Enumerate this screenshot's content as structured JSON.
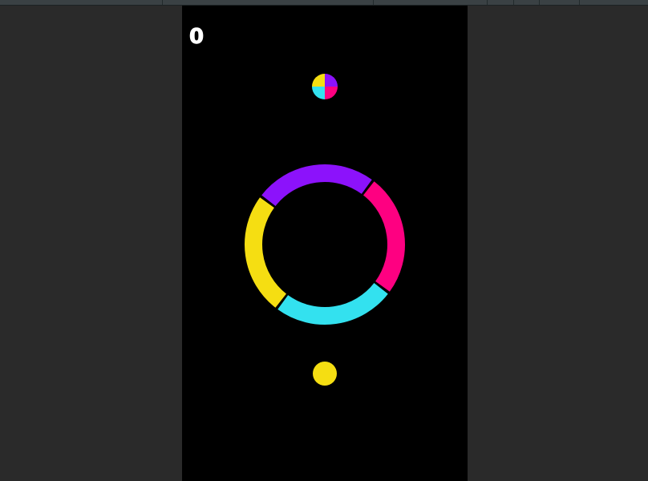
{
  "app": {
    "background": "#2a2a2a",
    "toolbar_color": "#3a4144"
  },
  "game": {
    "title": "",
    "score": "0",
    "colors": {
      "yellow": "#f5de12",
      "cyan": "#33e1ef",
      "purple": "#8c12fb",
      "pink": "#fe0081",
      "background": "#000000",
      "score_text": "#ffffff"
    },
    "ring": {
      "segments": [
        {
          "color_name": "purple"
        },
        {
          "color_name": "pink"
        },
        {
          "color_name": "cyan"
        },
        {
          "color_name": "yellow"
        }
      ]
    },
    "color_switcher": {
      "quadrants": [
        "purple",
        "pink",
        "cyan",
        "yellow"
      ]
    },
    "player_ball": {
      "color_name": "yellow"
    }
  }
}
